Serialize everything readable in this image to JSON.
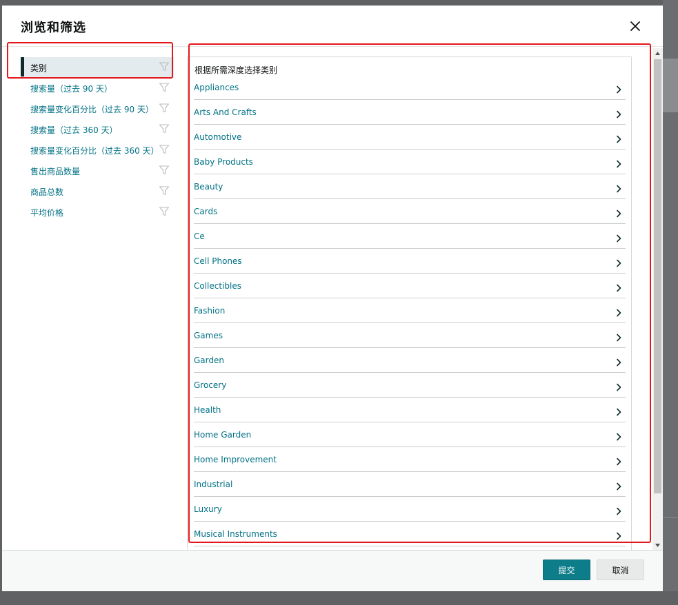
{
  "modal": {
    "title": "浏览和筛选"
  },
  "sidebar": {
    "items": [
      {
        "label": "类别",
        "active": true
      },
      {
        "label": "搜索量（过去 90 天）",
        "active": false
      },
      {
        "label": "搜索量变化百分比（过去 90 天）",
        "active": false
      },
      {
        "label": "搜索量（过去 360 天）",
        "active": false
      },
      {
        "label": "搜索量变化百分比（过去 360 天）",
        "active": false
      },
      {
        "label": "售出商品数量",
        "active": false
      },
      {
        "label": "商品总数",
        "active": false
      },
      {
        "label": "平均价格",
        "active": false
      }
    ]
  },
  "categories": {
    "hint": "根据所需深度选择类别",
    "items": [
      "Appliances",
      "Arts And Crafts",
      "Automotive",
      "Baby Products",
      "Beauty",
      "Cards",
      "Ce",
      "Cell Phones",
      "Collectibles",
      "Fashion",
      "Games",
      "Garden",
      "Grocery",
      "Health",
      "Home Garden",
      "Home Improvement",
      "Industrial",
      "Luxury",
      "Musical Instruments"
    ]
  },
  "footer": {
    "submit_label": "提交",
    "cancel_label": "取消"
  },
  "icons": {
    "close": "close-icon",
    "filter": "funnel-icon",
    "row_chevron": "chevron-right-icon",
    "scroll_up": "scroll-up-arrow-icon",
    "scroll_down": "scroll-down-arrow-icon"
  },
  "colors": {
    "link": "#007185",
    "active_bar": "#0f2a2e",
    "active_bg": "#e4ebee",
    "submit_bg": "#0d7d8a",
    "highlight_red": "#e4161a",
    "overlay": "#5f6163"
  }
}
